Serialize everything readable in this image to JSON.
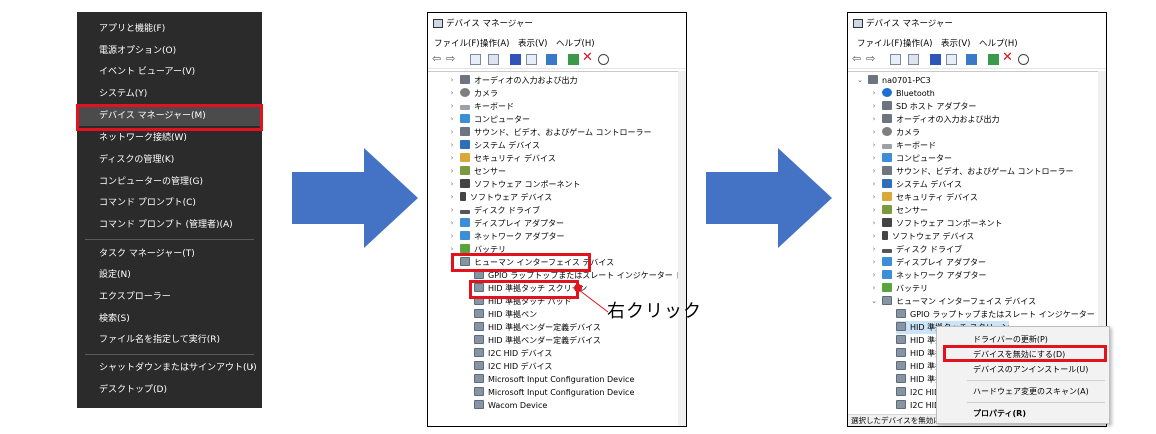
{
  "winx_menu": {
    "items": [
      {
        "label": "アプリと機能(F)"
      },
      {
        "label": "電源オプション(O)"
      },
      {
        "label": "イベント ビューアー(V)"
      },
      {
        "label": "システム(Y)"
      },
      {
        "label": "デバイス マネージャー(M)"
      },
      {
        "label": "ネットワーク接続(W)"
      },
      {
        "label": "ディスクの管理(K)"
      },
      {
        "label": "コンピューターの管理(G)"
      },
      {
        "label": "コマンド プロンプト(C)"
      },
      {
        "label": "コマンド プロンプト (管理者)(A)"
      },
      {
        "label": "タスク マネージャー(T)"
      },
      {
        "label": "設定(N)"
      },
      {
        "label": "エクスプローラー"
      },
      {
        "label": "検索(S)"
      },
      {
        "label": "ファイル名を指定して実行(R)"
      },
      {
        "label": "シャットダウンまたはサインアウト(U)"
      },
      {
        "label": "デスクトップ(D)"
      }
    ],
    "submenu_glyph": "›"
  },
  "window1": {
    "title": "デバイス マネージャー",
    "menu": [
      "ファイル(F)",
      "操作(A)",
      "表示(V)",
      "ヘルプ(H)"
    ],
    "tree": [
      "オーディオの入力および出力",
      "カメラ",
      "キーボード",
      "コンピューター",
      "サウンド、ビデオ、およびゲーム コントローラー",
      "システム デバイス",
      "セキュリティ デバイス",
      "センサー",
      "ソフトウェア コンポーネント",
      "ソフトウェア デバイス",
      "ディスク ドライブ",
      "ディスプレイ アダプター",
      "ネットワーク アダプター",
      "バッテリ",
      "ヒューマン インターフェイス デバイス",
      "GPIO ラップトップまたはスレート インジケーター ドライバー",
      "HID 準拠タッチ スクリーン",
      "HID 準拠タッチ パッド",
      "HID 準拠ペン",
      "HID 準拠ベンダー定義デバイス",
      "HID 準拠ベンダー定義デバイス",
      "I2C HID デバイス",
      "I2C HID デバイス",
      "Microsoft Input Configuration Device",
      "Microsoft Input Configuration Device",
      "Wacom Device"
    ]
  },
  "right_click_label": "右クリック",
  "window2": {
    "title": "デバイス マネージャー",
    "menu": [
      "ファイル(F)",
      "操作(A)",
      "表示(V)",
      "ヘルプ(H)"
    ],
    "root": "na0701-PC3",
    "tree": [
      "Bluetooth",
      "SD ホスト アダプター",
      "オーディオの入力および出力",
      "カメラ",
      "キーボード",
      "コンピューター",
      "サウンド、ビデオ、およびゲーム コントローラー",
      "システム デバイス",
      "セキュリティ デバイス",
      "センサー",
      "ソフトウェア コンポーネント",
      "ソフトウェア デバイス",
      "ディスク ドライブ",
      "ディスプレイ アダプター",
      "ネットワーク アダプター",
      "バッテリ",
      "ヒューマン インターフェイス デバイス",
      "GPIO ラップトップまたはスレート インジケーター ドライバー",
      "HID 準拠タッチ スクリーン",
      "HID 準拠",
      "HID 準拠",
      "HID 準拠",
      "HID 準拠",
      "I2C HID",
      "I2C HID"
    ],
    "context_menu": [
      "ドライバーの更新(P)",
      "デバイスを無効にする(D)",
      "デバイスのアンインストール(U)",
      "ハードウェア変更のスキャン(A)",
      "プロパティ(R)"
    ],
    "status": "選択したデバイスを無効にしま"
  },
  "colors": {
    "highlight_box": "#e2131c",
    "arrow": "#4472c4"
  }
}
